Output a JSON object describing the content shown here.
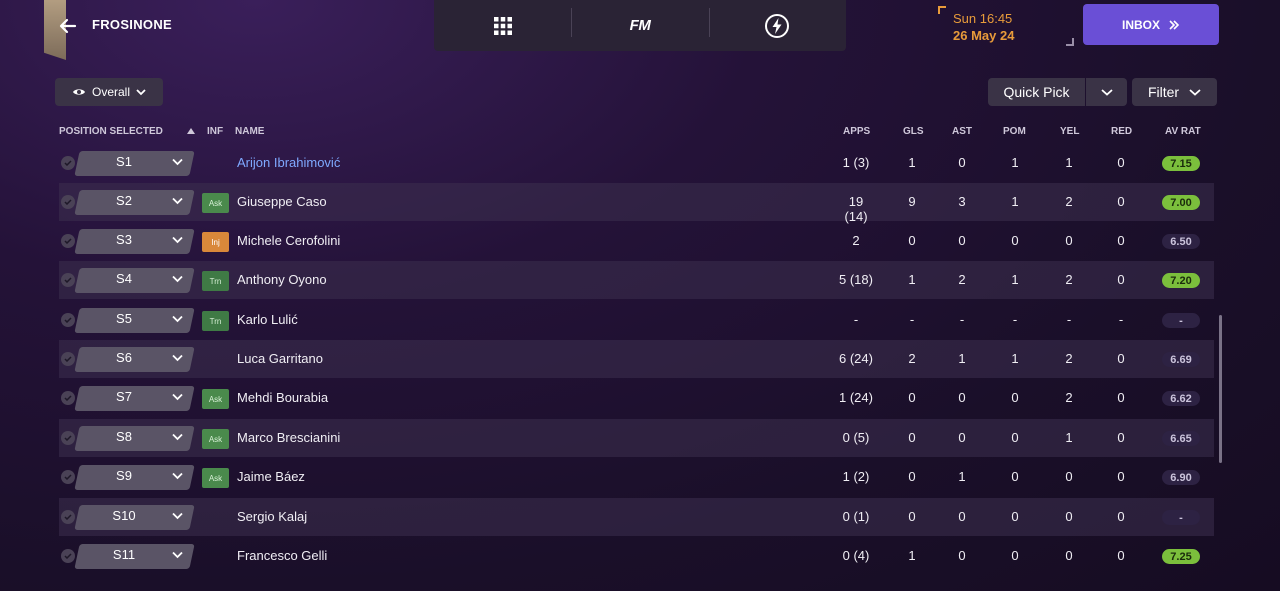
{
  "header": {
    "club_name": "FROSINONE",
    "date_time": "Sun 16:45",
    "date_day": "26 May 24",
    "inbox_label": "INBOX",
    "fm_logo": "FM"
  },
  "toolbar": {
    "overall_label": "Overall",
    "quick_pick_label": "Quick Pick",
    "filter_label": "Filter"
  },
  "table": {
    "headers": {
      "position": "POSITION SELECTED",
      "inf": "INF",
      "name": "NAME",
      "apps": "APPS",
      "gls": "GLS",
      "ast": "AST",
      "pom": "POM",
      "yel": "YEL",
      "red": "RED",
      "av_rat": "AV RAT"
    },
    "rows": [
      {
        "pos": "S1",
        "inf": "",
        "name": "Arijon Ibrahimović",
        "apps": "1 (3)",
        "gls": "1",
        "ast": "0",
        "pom": "1",
        "yel": "1",
        "red": "0",
        "rating": "7.15",
        "rating_style": "good",
        "highlight": true
      },
      {
        "pos": "S2",
        "inf": "Ask",
        "name": "Giuseppe Caso",
        "apps": "19 (14)",
        "gls": "9",
        "ast": "3",
        "pom": "1",
        "yel": "2",
        "red": "0",
        "rating": "7.00",
        "rating_style": "good"
      },
      {
        "pos": "S3",
        "inf": "Inj",
        "name": "Michele Cerofolini",
        "apps": "2",
        "gls": "0",
        "ast": "0",
        "pom": "0",
        "yel": "0",
        "red": "0",
        "rating": "6.50",
        "rating_style": "avg"
      },
      {
        "pos": "S4",
        "inf": "Trn",
        "name": "Anthony Oyono",
        "apps": "5 (18)",
        "gls": "1",
        "ast": "2",
        "pom": "1",
        "yel": "2",
        "red": "0",
        "rating": "7.20",
        "rating_style": "good"
      },
      {
        "pos": "S5",
        "inf": "Trn",
        "name": "Karlo Lulić",
        "apps": "-",
        "gls": "-",
        "ast": "-",
        "pom": "-",
        "yel": "-",
        "red": "-",
        "rating": "-",
        "rating_style": "avg"
      },
      {
        "pos": "S6",
        "inf": "",
        "name": "Luca Garritano",
        "apps": "6 (24)",
        "gls": "2",
        "ast": "1",
        "pom": "1",
        "yel": "2",
        "red": "0",
        "rating": "6.69",
        "rating_style": "avg"
      },
      {
        "pos": "S7",
        "inf": "Ask",
        "name": "Mehdi Bourabia",
        "apps": "1 (24)",
        "gls": "0",
        "ast": "0",
        "pom": "0",
        "yel": "2",
        "red": "0",
        "rating": "6.62",
        "rating_style": "avg"
      },
      {
        "pos": "S8",
        "inf": "Ask",
        "name": "Marco Brescianini",
        "apps": "0 (5)",
        "gls": "0",
        "ast": "0",
        "pom": "0",
        "yel": "1",
        "red": "0",
        "rating": "6.65",
        "rating_style": "avg"
      },
      {
        "pos": "S9",
        "inf": "Ask",
        "name": "Jaime Báez",
        "apps": "1 (2)",
        "gls": "0",
        "ast": "1",
        "pom": "0",
        "yel": "0",
        "red": "0",
        "rating": "6.90",
        "rating_style": "avg"
      },
      {
        "pos": "S10",
        "inf": "",
        "name": "Sergio Kalaj",
        "apps": "0 (1)",
        "gls": "0",
        "ast": "0",
        "pom": "0",
        "yel": "0",
        "red": "0",
        "rating": "-",
        "rating_style": "avg"
      },
      {
        "pos": "S11",
        "inf": "",
        "name": "Francesco Gelli",
        "apps": "0 (4)",
        "gls": "1",
        "ast": "0",
        "pom": "0",
        "yel": "0",
        "red": "0",
        "rating": "7.25",
        "rating_style": "good"
      }
    ]
  },
  "colors": {
    "accent": "#6a4fd6",
    "date": "#e89b3a",
    "rating_good": "#7bbf3c",
    "link": "#7fa9ff"
  }
}
